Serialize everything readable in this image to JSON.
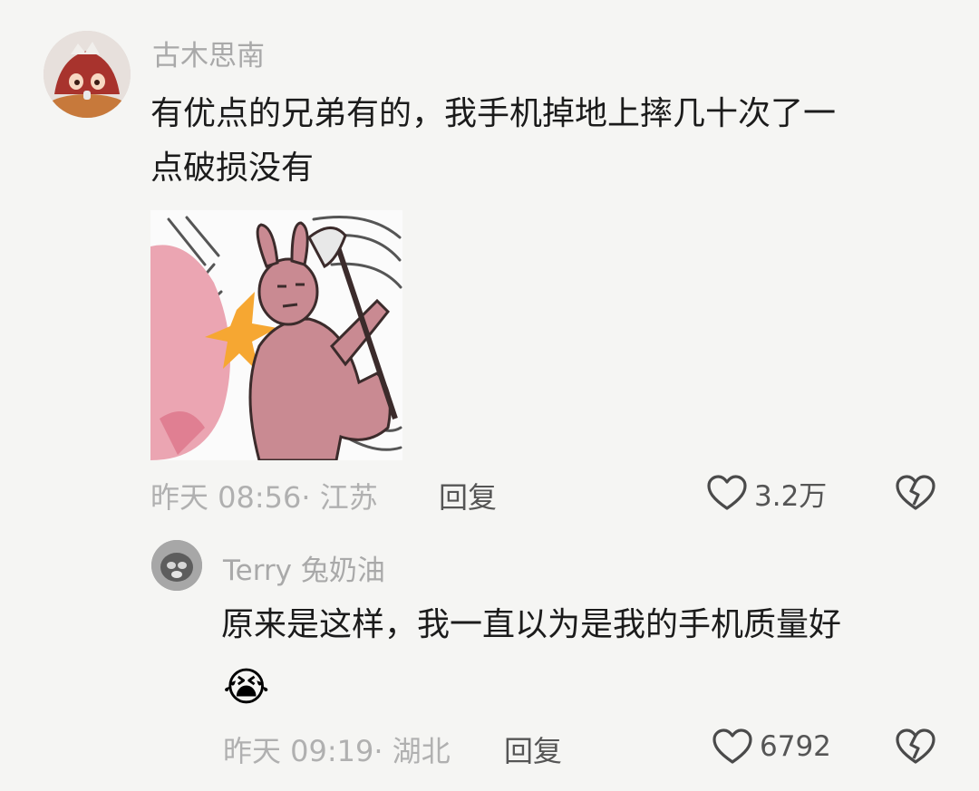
{
  "comment": {
    "username": "古木思南",
    "text_line1": "有优点的兄弟有的，我手机掉地上摔几十次了一",
    "text_line2": "点破损没有",
    "timestamp": "昨天 08:56",
    "location": "· 江苏",
    "reply_label": "回复",
    "likes": "3.2万"
  },
  "reply": {
    "username": "Terry 兔奶油",
    "text": "原来是这样，我一直以为是我的手机质量好",
    "emoji": "😭",
    "timestamp": "昨天 09:19",
    "location": "· 湖北",
    "reply_label": "回复",
    "likes": "6792"
  },
  "icons": {
    "like": "heart-outline-icon",
    "dislike": "broken-heart-icon"
  },
  "colors": {
    "background": "#f5f5f3",
    "username": "#a9a9a9",
    "text": "#1b1b1b",
    "meta": "#b0b0b0",
    "sticker_bunny": "#c98a92"
  }
}
